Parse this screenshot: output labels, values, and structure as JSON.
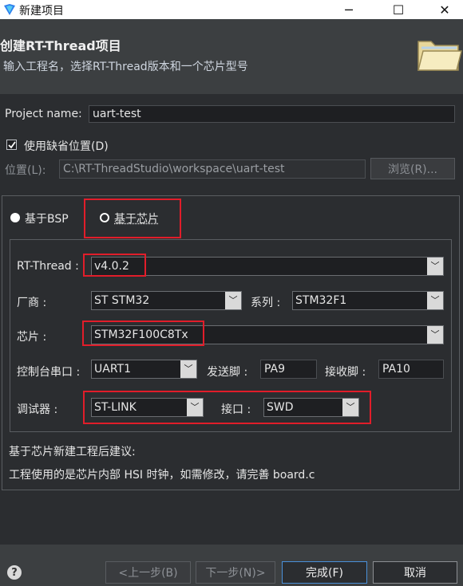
{
  "window": {
    "title": "新建项目",
    "min_glyph": "─",
    "max_glyph": "☐",
    "close_glyph": "✕"
  },
  "header": {
    "title": "创建RT-Thread项目",
    "subtitle": "输入工程名，选择RT-Thread版本和一个芯片型号"
  },
  "project": {
    "name_label": "Project name:",
    "name_value": "uart-test"
  },
  "location": {
    "default_checkbox_label": "使用缺省位置(D)",
    "default_checked": true,
    "path_label": "位置(L):",
    "path_value": "C:\\RT-ThreadStudio\\workspace\\uart-test",
    "browse_label": "浏览(R)..."
  },
  "mode": {
    "bsp_label": "基于BSP",
    "chip_label": "基于芯片",
    "selected": "chip"
  },
  "form": {
    "rtthread_label": "RT-Thread :",
    "rtthread_value": "v4.0.2",
    "vendor_label": "厂商 :",
    "vendor_value": "ST STM32",
    "series_label": "系列 :",
    "series_value": "STM32F1",
    "chip_label": "芯片 :",
    "chip_value": "STM32F100C8Tx",
    "console_label": "控制台串口 :",
    "console_value": "UART1",
    "tx_label": "发送脚 :",
    "tx_value": "PA9",
    "rx_label": "接收脚 :",
    "rx_value": "PA10",
    "debugger_label": "调试器 :",
    "debugger_value": "ST-LINK",
    "interface_label": "接口 :",
    "interface_value": "SWD"
  },
  "advice": {
    "title": "基于芯片新建工程后建议:",
    "text": "工程使用的是芯片内部 HSI 时钟，如需修改，请完善 board.c"
  },
  "footer": {
    "help_glyph": "?",
    "back_label": "<上一步(B)",
    "next_label": "下一步(N)>",
    "finish_label": "完成(F)",
    "cancel_label": "取消"
  },
  "colors": {
    "highlight": "#e11d2a",
    "background": "#2b2d30",
    "header": "#3c3f41"
  }
}
